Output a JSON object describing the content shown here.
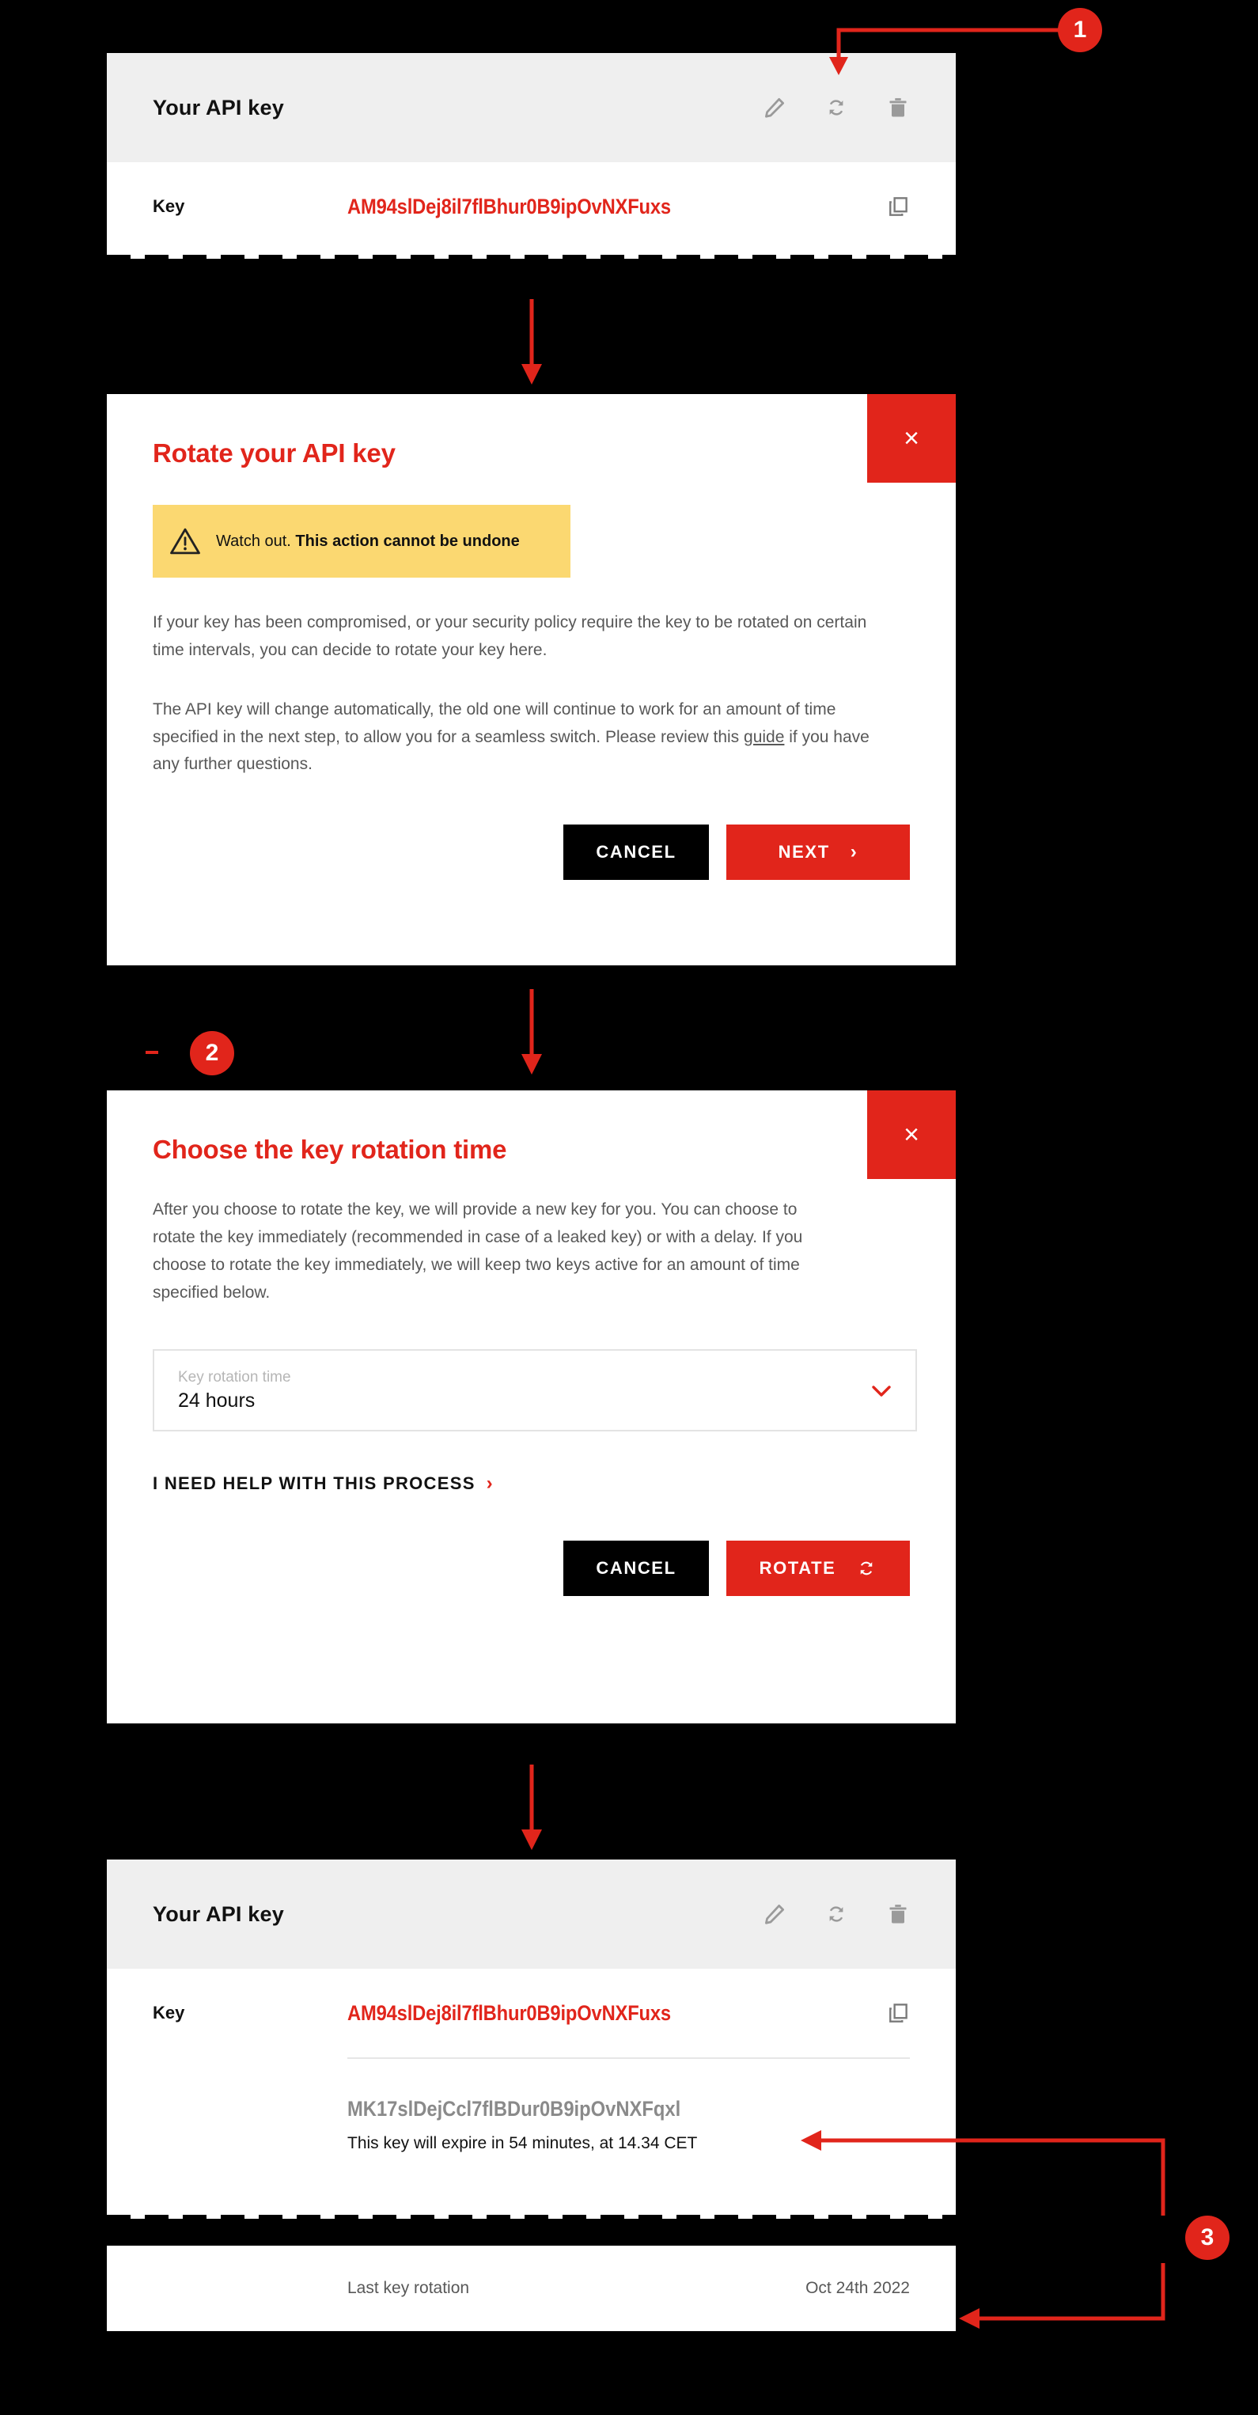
{
  "annotations": {
    "badges": [
      {
        "label": "1"
      },
      {
        "label": "2"
      },
      {
        "label": "3"
      }
    ]
  },
  "colors": {
    "brand_red": "#E1251B",
    "warning_yellow": "#FBD871",
    "header_grey": "#EFEFEF",
    "body_grey": "#585858",
    "old_key_grey": "#8A8A8A",
    "background": "#000000"
  },
  "card_top": {
    "title": "Your API key",
    "icons": [
      {
        "name": "edit-pencil-icon"
      },
      {
        "name": "rotate-refresh-icon"
      },
      {
        "name": "trash-delete-icon"
      }
    ],
    "key_label": "Key",
    "key_value": "AM94slDej8il7flBhur0B9ipOvNXFuxs",
    "copy_icon": "copy-icon"
  },
  "modal_rotate": {
    "title": "Rotate your API key",
    "close_label": "×",
    "warning": {
      "icon": "warning-triangle-icon",
      "prefix": "Watch out. ",
      "strong": "This action cannot be undone"
    },
    "paragraph_1": "If your key has been compromised, or your security policy require the key to be rotated on certain time intervals, you can decide to rotate your key here.",
    "paragraph_2_before": "The API key will change automatically, the old one will continue to work for an amount of time specified in the next step, to allow you for a seamless switch. Please review this ",
    "paragraph_2_link": "guide",
    "paragraph_2_after": " if you have any further questions.",
    "cancel_label": "CANCEL",
    "next_label": "NEXT",
    "next_chevron": "›"
  },
  "modal_rotation_time": {
    "title": "Choose the key rotation time",
    "close_label": "×",
    "paragraph": "After you choose to rotate the key, we will provide a new key for you. You can choose to rotate the key immediately (recommended in case of a leaked key) or with a delay. If you choose to rotate the key immediately, we will keep two keys active for an amount of time specified below.",
    "select": {
      "label": "Key rotation time",
      "value": "24 hours",
      "chevron": "⌄",
      "options": [
        "24 hours"
      ]
    },
    "help_link": "I NEED HELP WITH THIS PROCESS",
    "help_chevron": "›",
    "cancel_label": "CANCEL",
    "rotate_label": "ROTATE"
  },
  "card_bottom": {
    "title": "Your API key",
    "icons": [
      {
        "name": "edit-pencil-icon"
      },
      {
        "name": "rotate-refresh-icon"
      },
      {
        "name": "trash-delete-icon"
      }
    ],
    "key_label": "Key",
    "key_value": "AM94slDej8il7flBhur0B9ipOvNXFuxs",
    "copy_icon": "copy-icon",
    "old_key_value": "MK17slDejCcl7flBDur0B9ipOvNXFqxl",
    "old_key_note": "This key will expire in 54 minutes, at 14.34 CET"
  },
  "footer": {
    "label": "Last key rotation",
    "value": "Oct 24th 2022"
  }
}
